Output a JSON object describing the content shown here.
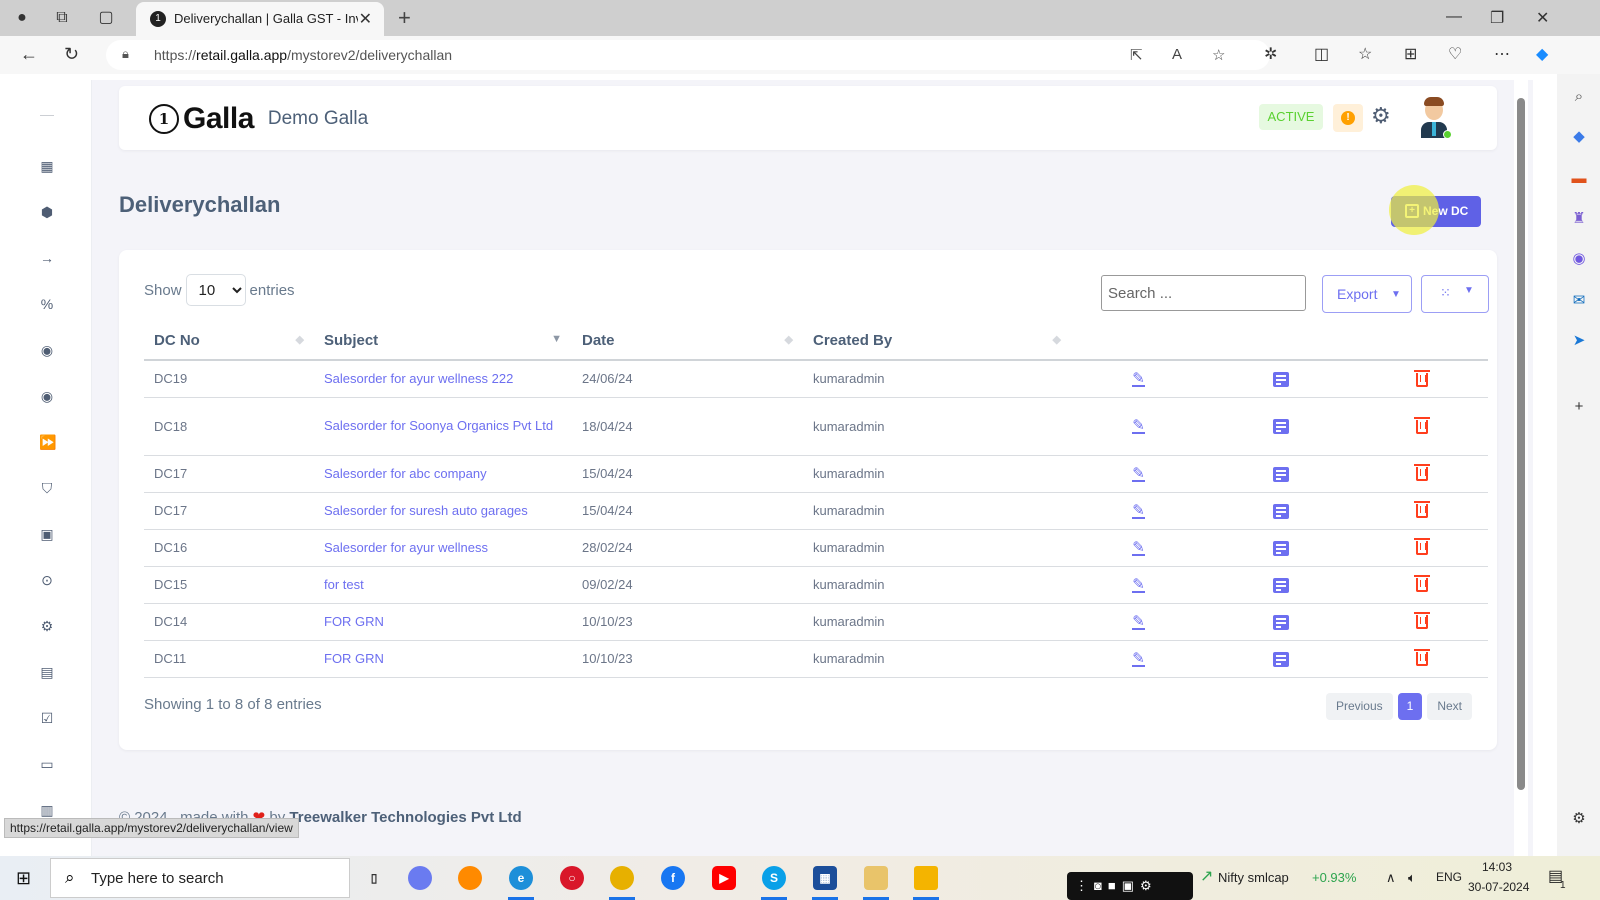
{
  "browser": {
    "tab_title": "Deliverychallan | Galla GST - Inve",
    "url_prefix": "https://",
    "url_host": "retail.galla.app",
    "url_path": "/mystorev2/deliverychallan",
    "status_url": "https://retail.galla.app/mystorev2/deliverychallan/view"
  },
  "header": {
    "brand": "Galla",
    "logo_glyph": "1",
    "store_name": "Demo Galla",
    "status_badge": "ACTIVE",
    "warning_glyph": "!"
  },
  "page": {
    "title": "Deliverychallan",
    "new_button": "New DC"
  },
  "table_controls": {
    "show_label": "Show",
    "entries_label": "entries",
    "page_length": "10",
    "page_length_options": [
      "10"
    ],
    "search_placeholder": "Search ...",
    "export_label": "Export"
  },
  "table": {
    "columns": [
      "DC No",
      "Subject",
      "Date",
      "Created By"
    ],
    "rows": [
      {
        "dc_no": "DC19",
        "subject": "Salesorder for ayur wellness 222",
        "date": "24/06/24",
        "created_by": "kumaradmin"
      },
      {
        "dc_no": "DC18",
        "subject": "Salesorder for Soonya Organics Pvt Ltd",
        "date": "18/04/24",
        "created_by": "kumaradmin"
      },
      {
        "dc_no": "DC17",
        "subject": "Salesorder for abc company",
        "date": "15/04/24",
        "created_by": "kumaradmin"
      },
      {
        "dc_no": "DC17",
        "subject": "Salesorder for suresh auto garages",
        "date": "15/04/24",
        "created_by": "kumaradmin"
      },
      {
        "dc_no": "DC16",
        "subject": "Salesorder for ayur wellness",
        "date": "28/02/24",
        "created_by": "kumaradmin"
      },
      {
        "dc_no": "DC15",
        "subject": "for test",
        "date": "09/02/24",
        "created_by": "kumaradmin"
      },
      {
        "dc_no": "DC14",
        "subject": "FOR GRN",
        "date": "10/10/23",
        "created_by": "kumaradmin"
      },
      {
        "dc_no": "DC11",
        "subject": "FOR GRN",
        "date": "10/10/23",
        "created_by": "kumaradmin"
      }
    ],
    "info": "Showing 1 to 8 of 8 entries",
    "pagination": {
      "previous": "Previous",
      "current": "1",
      "next": "Next"
    }
  },
  "footer": {
    "prefix": "© 2024 , made with",
    "heart": "❤",
    "by": "by",
    "company": "Treewalker Technologies Pvt Ltd"
  },
  "sidebar": {
    "items": [
      "menu-toggle",
      "dashboard",
      "products",
      "arrow",
      "offers",
      "customers",
      "vendors",
      "fast-forward",
      "purchase",
      "contacts",
      "location",
      "settings",
      "reports",
      "tasks",
      "cash",
      "calendar"
    ]
  },
  "taskbar": {
    "search_placeholder": "Type here to search",
    "ticker_name": "Nifty smlcap",
    "ticker_change": "+0.93%",
    "language": "ENG",
    "time": "14:03",
    "date": "30-07-2024",
    "notification_count": "1"
  },
  "colors": {
    "accent": "#6d6ff0",
    "danger": "#ff3e1d",
    "active_green": "#5ad130",
    "warning": "#ffa000"
  }
}
